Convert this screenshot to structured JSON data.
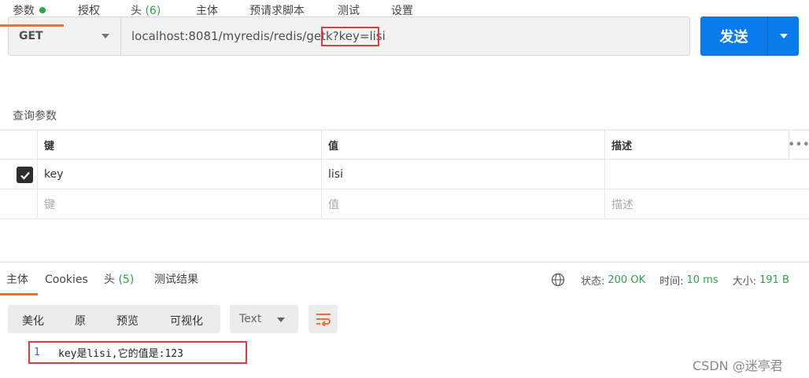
{
  "request": {
    "method": "GET",
    "url": "localhost:8081/myredis/redis/getk?key=lisi",
    "send_label": "发送"
  },
  "req_tabs": {
    "params": "参数",
    "auth": "授权",
    "headers": "头",
    "headers_count": "(6)",
    "body": "主体",
    "prerequest": "预请求脚本",
    "tests": "测试",
    "settings": "设置"
  },
  "query_section_label": "查询参数",
  "params_table": {
    "headers": {
      "key": "键",
      "value": "值",
      "description": "描述",
      "more": "•••"
    },
    "rows": [
      {
        "key": "key",
        "value": "lisi",
        "description": ""
      }
    ],
    "placeholder": {
      "key": "键",
      "value": "值",
      "description": "描述"
    }
  },
  "resp_tabs": {
    "body": "主体",
    "cookies": "Cookies",
    "headers": "头",
    "headers_count": "(5)",
    "test_results": "测试结果"
  },
  "status": {
    "status_label": "状态:",
    "status_value": "200 OK",
    "time_label": "时间:",
    "time_value": "10 ms",
    "size_label": "大小:",
    "size_value": "191 B"
  },
  "format": {
    "pretty": "美化",
    "raw": "原",
    "preview": "预览",
    "visualize": "可视化",
    "type": "Text"
  },
  "response_body": {
    "line_number": "1",
    "text": "key是lisi,它的值是:123"
  },
  "watermark": "CSDN @迷亭君",
  "colors": {
    "accent": "#f26b3a",
    "send_button": "#097bed",
    "success": "#28a745",
    "highlight_box": "#e0393e"
  }
}
